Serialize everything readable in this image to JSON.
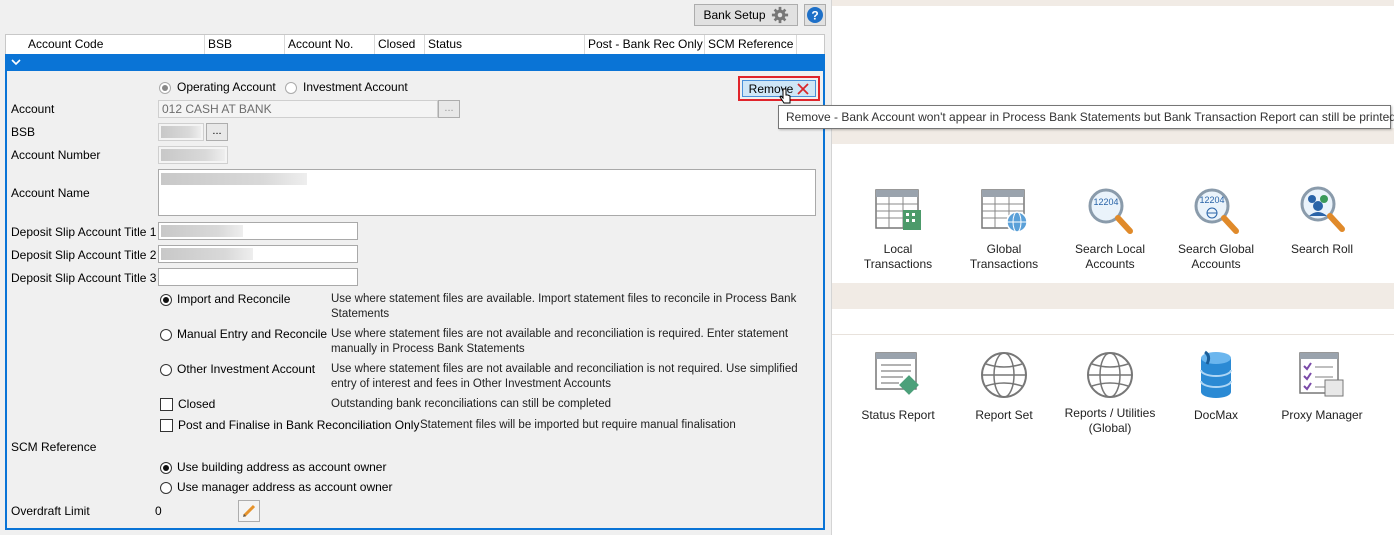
{
  "toolbar": {
    "bank_setup_label": "Bank Setup",
    "help_icon": "question-mark-icon"
  },
  "grid": {
    "columns": [
      "Account Code",
      "BSB",
      "Account No.",
      "Closed",
      "Status",
      "Post - Bank Rec Only",
      "SCM Reference"
    ]
  },
  "form": {
    "account_type_options": [
      "Operating Account",
      "Investment Account"
    ],
    "account_type_selected": "Operating Account",
    "remove_label": "Remove",
    "account_label": "Account",
    "account_value": "012 CASH AT BANK",
    "browse_label": "...",
    "bsb_label": "BSB",
    "account_number_label": "Account Number",
    "account_name_label": "Account Name",
    "deposit_title_1_label": "Deposit Slip Account Title 1",
    "deposit_title_2_label": "Deposit Slip Account Title 2",
    "deposit_title_3_label": "Deposit Slip Account Title 3",
    "reconcile_options": [
      {
        "label": "Import and Reconcile",
        "desc_line1": "Use where statement files are available.  Import statement files to reconcile in Process Bank",
        "desc_line2": "Statements",
        "selected": true
      },
      {
        "label": "Manual Entry and Reconcile",
        "desc_line1": "Use where statement files are not available and reconciliation is required.  Enter statement",
        "desc_line2": "manually in Process Bank Statements",
        "selected": false
      },
      {
        "label": "Other Investment Account",
        "desc_line1": "Use where statement files are not available and reconciliation is not required.  Use simplified",
        "desc_line2": "entry of interest and fees in Other Investment Accounts",
        "selected": false
      }
    ],
    "closed_label": "Closed",
    "closed_desc": "Outstanding bank reconciliations can still be completed",
    "post_finalise_label": "Post and Finalise in Bank Reconciliation Only",
    "post_finalise_desc": "Statement files will be imported but require manual finalisation",
    "scm_reference_label": "SCM Reference",
    "owner_options": [
      {
        "label": "Use building address as account owner",
        "selected": true
      },
      {
        "label": "Use manager address as account owner",
        "selected": false
      }
    ],
    "overdraft_label": "Overdraft Limit",
    "overdraft_value": "0"
  },
  "tooltip": {
    "text": "Remove - Bank Account won't appear in Process Bank Statements but Bank Transaction Report can still be printed"
  },
  "launcher": {
    "row1": [
      {
        "icon": "local-transactions-icon",
        "line1": "Local",
        "line2": "Transactions"
      },
      {
        "icon": "global-transactions-icon",
        "line1": "Global",
        "line2": "Transactions"
      },
      {
        "icon": "search-local-accounts-icon",
        "line1": "Search Local",
        "line2": "Accounts",
        "badge": "12204"
      },
      {
        "icon": "search-global-accounts-icon",
        "line1": "Search Global",
        "line2": "Accounts",
        "badge": "12204"
      },
      {
        "icon": "search-roll-icon",
        "line1": "Search Roll",
        "line2": ""
      }
    ],
    "row2": [
      {
        "icon": "status-report-icon",
        "line1": "Status Report",
        "line2": ""
      },
      {
        "icon": "report-set-icon",
        "line1": "Report Set",
        "line2": ""
      },
      {
        "icon": "reports-utilities-globe-icon",
        "line1": "Reports / Utilities",
        "line2": "(Global)"
      },
      {
        "icon": "docmax-database-icon",
        "line1": "DocMax",
        "line2": ""
      },
      {
        "icon": "proxy-manager-icon",
        "line1": "Proxy Manager",
        "line2": ""
      }
    ]
  },
  "colors": {
    "accent_blue": "#0a74d6",
    "remove_highlight": "#e0242b",
    "section_band": "#f1ebe5"
  }
}
